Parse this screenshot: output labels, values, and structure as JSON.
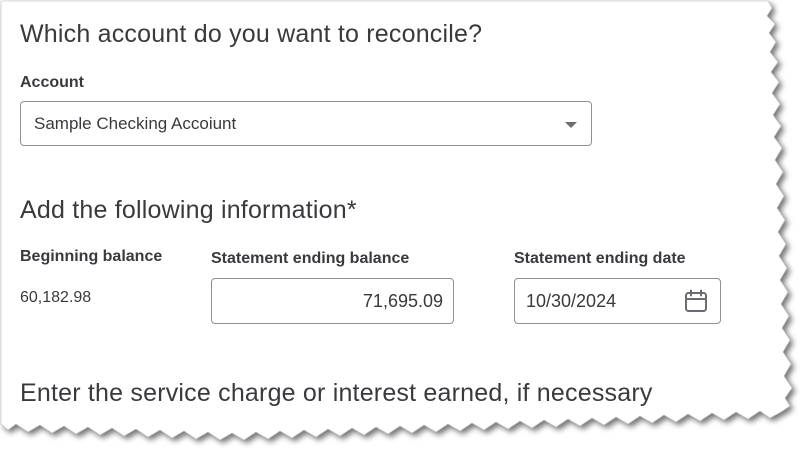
{
  "account_section": {
    "heading": "Which account do you want to reconcile?",
    "account_label": "Account",
    "account_value": "Sample Checking Accoiunt"
  },
  "info_section": {
    "heading": "Add the following information*",
    "beginning_balance_label": "Beginning balance",
    "beginning_balance_value": "60,182.98",
    "ending_balance_label": "Statement ending balance",
    "ending_balance_value": "71,695.09",
    "ending_date_label": "Statement ending date",
    "ending_date_value": "10/30/2024"
  },
  "service_section": {
    "heading": "Enter the service charge or interest earned, if necessary"
  },
  "icons": {
    "dropdown": "chevron-down-icon",
    "calendar": "calendar-icon"
  },
  "colors": {
    "text": "#393a3d",
    "border": "#8d9096"
  }
}
